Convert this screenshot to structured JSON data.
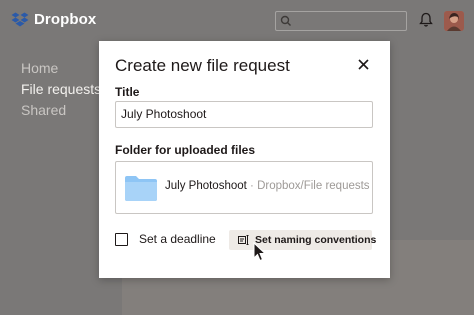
{
  "app": {
    "brand": "Dropbox"
  },
  "header": {
    "search_placeholder": ""
  },
  "sidebar": {
    "items": [
      {
        "label": "Home",
        "active": false
      },
      {
        "label": "File requests",
        "active": true
      },
      {
        "label": "Shared",
        "active": false
      }
    ]
  },
  "modal": {
    "title": "Create new file request",
    "title_field": {
      "label": "Title",
      "value": "July Photoshoot"
    },
    "folder_field": {
      "label": "Folder for uploaded files",
      "folder_name": "July Photoshoot",
      "folder_path": " · Dropbox/File requests"
    },
    "deadline_label": "Set a deadline",
    "naming_label": "Set naming conventions"
  },
  "colors": {
    "brand": "#0061fe",
    "folder": "#8ec5f5",
    "overlay": "#7a7877"
  },
  "icons": [
    "dropbox-logo-icon",
    "search-icon",
    "bell-icon",
    "close-icon",
    "folder-icon",
    "naming-conventions-icon",
    "mouse-pointer-icon"
  ]
}
